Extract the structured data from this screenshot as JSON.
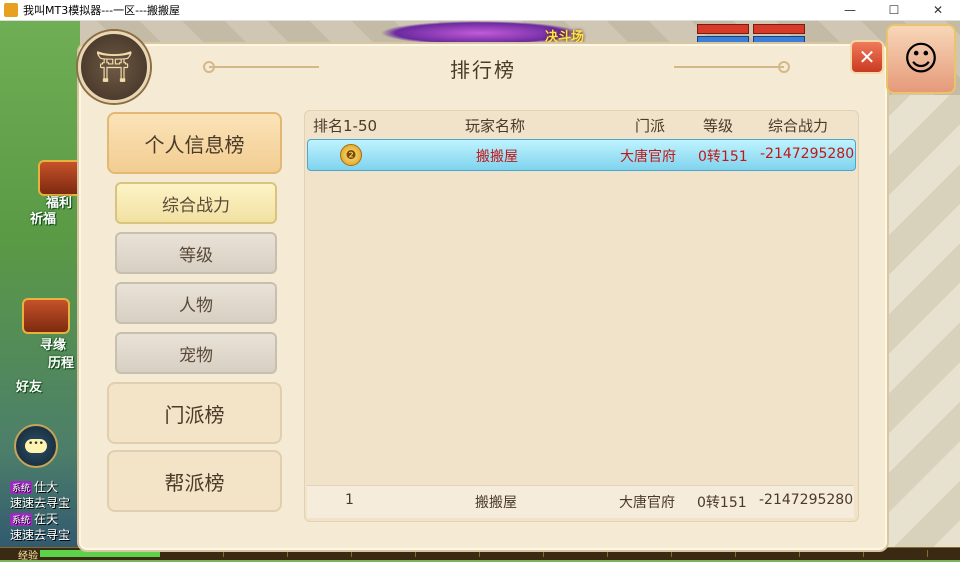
{
  "window": {
    "title": "我叫MT3模拟器---一区---搬搬屋",
    "minimize": "—",
    "maximize": "☐",
    "close": "✕"
  },
  "game_hud": {
    "top_banner": "决斗场",
    "left_labels": [
      "福利",
      "祈福",
      "寻缘",
      "历程",
      "好友"
    ],
    "chat_icon": "•••",
    "system_lines": [
      {
        "tag": "系统",
        "text": "仕大"
      },
      {
        "tag": "",
        "text": "速速去寻宝"
      },
      {
        "tag": "系统",
        "text": "在天"
      },
      {
        "tag": "",
        "text": "速速去寻宝"
      }
    ],
    "exp_label": "经验",
    "exp_fraction": 0.13
  },
  "panel": {
    "title": "排行榜",
    "close_label": "✕"
  },
  "tabs": {
    "personal": "个人信息榜",
    "sub": [
      "综合战力",
      "等级",
      "人物",
      "宠物"
    ],
    "sect": "门派榜",
    "guild": "帮派榜"
  },
  "table": {
    "headers": {
      "rank": "排名1-50",
      "name": "玩家名称",
      "sect": "门派",
      "level": "等级",
      "power": "综合战力"
    },
    "rows": [
      {
        "rank_icon": "medal-icon",
        "name": "搬搬屋",
        "sect": "大唐官府",
        "level": "0转151",
        "power": "-2147295280"
      }
    ],
    "self_row": {
      "rank": "1",
      "name": "搬搬屋",
      "sect": "大唐官府",
      "level": "0转151",
      "power": "-2147295280"
    }
  },
  "colors": {
    "panel_bg": "#f5ead3",
    "highlight_row": "#7fd3ee",
    "highlight_text": "#c01818",
    "close_button": "#c93a22"
  }
}
